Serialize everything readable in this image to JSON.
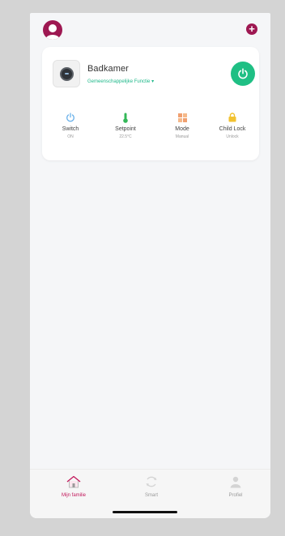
{
  "colors": {
    "brand": "#9e1852",
    "accent_green": "#1fbf84",
    "background": "#f5f6f8"
  },
  "header": {
    "avatar_icon": "user-avatar-icon",
    "add_icon": "plus-circle-icon",
    "add_label": "+"
  },
  "device": {
    "name": "Badkamer",
    "subtitle": "Gemeenschappelijke Functie",
    "subtitle_chevron": "▾",
    "power_icon": "power-icon",
    "functions": [
      {
        "label": "Switch",
        "value": "ON",
        "icon": "power-icon",
        "color": "#6cb2ea"
      },
      {
        "label": "Setpoint",
        "value": "22.5°C",
        "icon": "thermometer-icon",
        "color": "#34b859"
      },
      {
        "label": "Mode",
        "value": "Manual",
        "icon": "grid-icon",
        "color": "#f0a070"
      },
      {
        "label": "Child Lock",
        "value": "Unlock",
        "icon": "lock-icon",
        "color": "#f2c230"
      }
    ]
  },
  "tabbar": {
    "tabs": [
      {
        "label": "Mijn familie",
        "icon": "home-icon",
        "active": true
      },
      {
        "label": "Smart",
        "icon": "smart-icon",
        "active": false
      },
      {
        "label": "Profiel",
        "icon": "profile-icon",
        "active": false
      }
    ]
  }
}
